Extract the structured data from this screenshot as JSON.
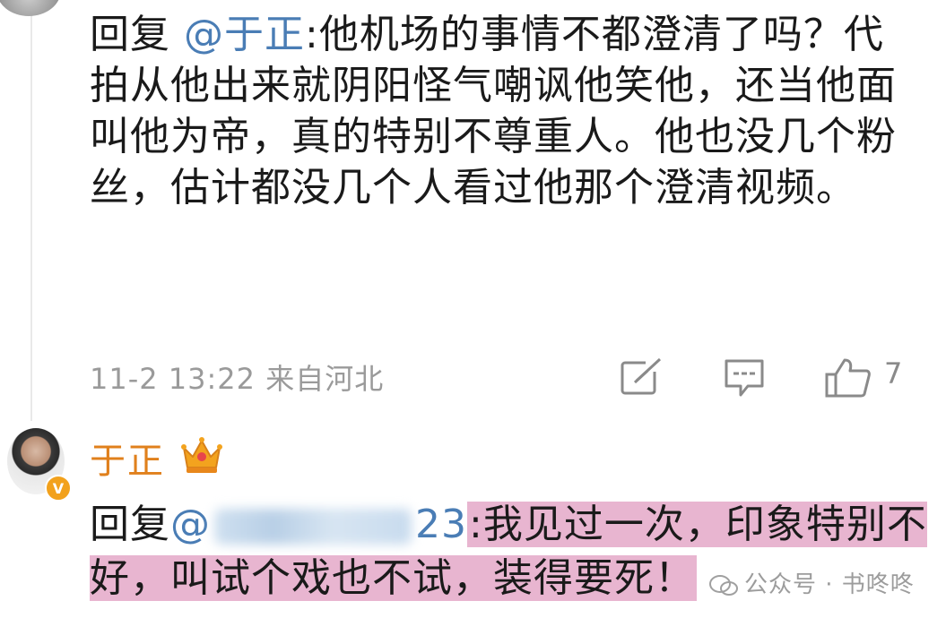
{
  "comment": {
    "reply_prefix": "回复",
    "mention": "@于正",
    "text": ":他机场的事情不都澄清了吗？代拍从他出来就阴阳怪气嘲讽他笑他，还当他面叫他为帝，真的特别不尊重人。他也没几个粉丝，估计都没几个人看过他那个澄清视频。",
    "timestamp": "11-2 13:22",
    "location": "来自河北",
    "like_count": "7",
    "icons": [
      "share-icon",
      "comment-icon",
      "like-icon"
    ]
  },
  "reply": {
    "username": "于正",
    "badge_icon": "crown-icon",
    "vip_badge": "V",
    "reply_prefix": "回复",
    "mention_visible": "@",
    "mention_tail": "23",
    "text": ":我见过一次，印象特别不好，叫试个戏也不试，装得要死！"
  },
  "watermark": {
    "text": "公众号 · 书咚咚"
  },
  "colors": {
    "mention": "#4a7db5",
    "username": "#e0801c",
    "highlight": "#d678aa",
    "meta": "#9a9a9a"
  }
}
